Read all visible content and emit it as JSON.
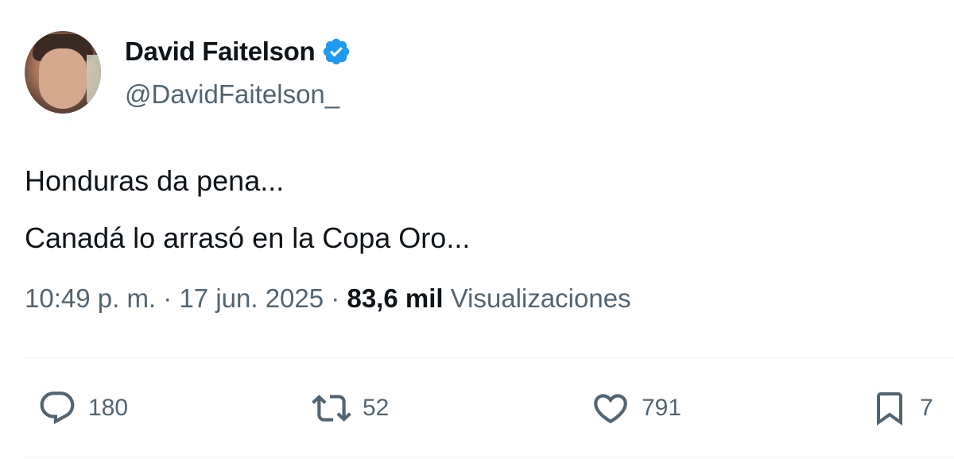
{
  "author": {
    "name": "David Faitelson",
    "handle": "@DavidFaitelson_",
    "verified_color": "#1d9bf0"
  },
  "tweet": {
    "lines": [
      "Honduras da pena...",
      "Canadá lo arrasó en la Copa Oro..."
    ],
    "time": "10:49 p. m.",
    "separator": "·",
    "date": "17 jun. 2025",
    "views_count": "83,6 mil",
    "views_label": "Visualizaciones"
  },
  "actions": {
    "reply_icon": "reply-icon",
    "reply_count": "180",
    "retweet_icon": "retweet-icon",
    "retweet_count": "52",
    "like_icon": "heart-icon",
    "like_count": "791",
    "bookmark_icon": "bookmark-icon",
    "bookmark_count": "7"
  },
  "colors": {
    "text_primary": "#0f1419",
    "text_secondary": "#536471",
    "divider": "#eff3f4"
  }
}
